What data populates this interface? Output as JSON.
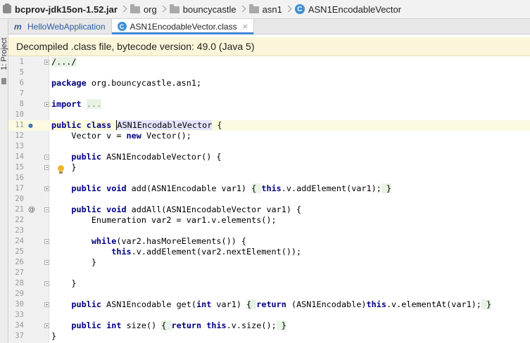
{
  "breadcrumb": {
    "jar": "bcprov-jdk15on-1.52.jar",
    "org": "org",
    "bouncycastle": "bouncycastle",
    "asn1": "asn1",
    "class": "ASN1EncodableVector"
  },
  "tool_stripe": {
    "project_label": "1: Project"
  },
  "tabs": [
    {
      "label": "HelloWebApplication",
      "icon": "m-module-icon",
      "active": false
    },
    {
      "label": "ASN1EncodableVector.class",
      "icon": "class-icon",
      "active": true,
      "close": "×"
    }
  ],
  "banner": {
    "text": "Decompiled .class file, bytecode version: 49.0 (Java 5)"
  },
  "icons": {
    "class_letter": "C",
    "module_letter": "m",
    "usage_marker": "@"
  },
  "editor": {
    "lines": [
      {
        "num": "1",
        "code": "/.../"
      },
      {
        "num": "5",
        "code": ""
      },
      {
        "num": "6",
        "code": "package org.bouncycastle.asn1;"
      },
      {
        "num": "7",
        "code": ""
      },
      {
        "num": "8",
        "code": "import ..."
      },
      {
        "num": "10",
        "code": ""
      },
      {
        "num": "11",
        "code": "public class ASN1EncodableVector {"
      },
      {
        "num": "12",
        "code": "    Vector v = new Vector();"
      },
      {
        "num": "13",
        "code": ""
      },
      {
        "num": "14",
        "code": "    public ASN1EncodableVector() {"
      },
      {
        "num": "15",
        "code": "    }"
      },
      {
        "num": "16",
        "code": ""
      },
      {
        "num": "17",
        "code": "    public void add(ASN1Encodable var1) { this.v.addElement(var1); }"
      },
      {
        "num": "20",
        "code": ""
      },
      {
        "num": "21",
        "code": "    public void addAll(ASN1EncodableVector var1) {"
      },
      {
        "num": "22",
        "code": "        Enumeration var2 = var1.v.elements();"
      },
      {
        "num": "23",
        "code": ""
      },
      {
        "num": "24",
        "code": "        while(var2.hasMoreElements()) {"
      },
      {
        "num": "25",
        "code": "            this.v.addElement(var2.nextElement());"
      },
      {
        "num": "26",
        "code": "        }"
      },
      {
        "num": "27",
        "code": ""
      },
      {
        "num": "28",
        "code": "    }"
      },
      {
        "num": "29",
        "code": ""
      },
      {
        "num": "30",
        "code": "    public ASN1Encodable get(int var1) { return (ASN1Encodable)this.v.elementAt(var1); }"
      },
      {
        "num": "33",
        "code": ""
      },
      {
        "num": "34",
        "code": "    public int size() { return this.v.size(); }"
      },
      {
        "num": "37",
        "code": "}"
      }
    ]
  },
  "colors": {
    "keyword": "#000080",
    "fold_highlight": "#e8f3e5",
    "usage_highlight": "#e4e4ff",
    "current_line": "#fcfae1",
    "banner_bg": "#fbf6d9",
    "tab_accent": "#3f86d6"
  }
}
